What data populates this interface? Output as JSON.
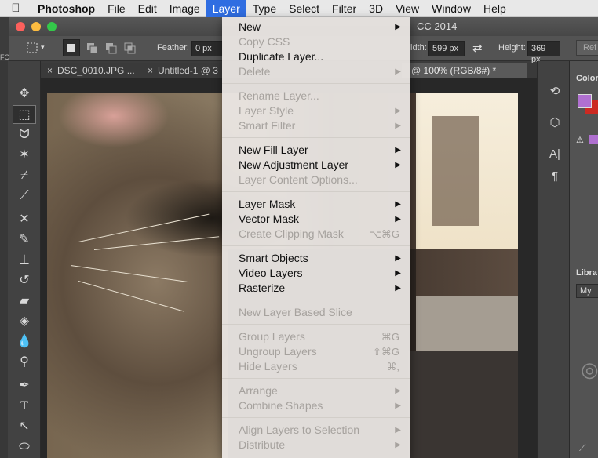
{
  "menubar": {
    "app": "Photoshop",
    "items": [
      "File",
      "Edit",
      "Image",
      "Layer",
      "Type",
      "Select",
      "Filter",
      "3D",
      "View",
      "Window",
      "Help"
    ],
    "active": "Layer"
  },
  "window": {
    "title_fragment": "CC 2014"
  },
  "options_bar": {
    "feather_label": "Feather:",
    "feather_value": "0 px",
    "width_label": "idth:",
    "width_value": "599 px",
    "height_label": "Height:",
    "height_value": "369 px",
    "refine_label": "Ref"
  },
  "tabs": [
    {
      "label": "DSC_0010.JPG ...",
      "active": false
    },
    {
      "label": "Untitled-1 @ 3",
      "active": false
    },
    {
      "label": "@ 100% (RGB/8#) *",
      "active": true
    }
  ],
  "left_edge_text": "FC",
  "tools": [
    "move-icon",
    "marquee-icon",
    "lasso-icon",
    "magic-wand-icon",
    "crop-icon",
    "eyedropper-icon",
    "healing-icon",
    "brush-icon",
    "stamp-icon",
    "history-brush-icon",
    "eraser-icon",
    "paint-bucket-icon",
    "blur-icon",
    "dodge-icon",
    "pen-icon",
    "type-icon",
    "path-select-icon",
    "shape-icon"
  ],
  "right_panel": {
    "color_label": "Color",
    "library_label": "Libra",
    "library_select": "My"
  },
  "layer_menu": {
    "items": [
      {
        "label": "New",
        "enabled": true,
        "submenu": true
      },
      {
        "label": "Copy CSS",
        "enabled": false
      },
      {
        "label": "Duplicate Layer...",
        "enabled": true
      },
      {
        "label": "Delete",
        "enabled": false,
        "submenu": true
      },
      {
        "label": "Rename Layer...",
        "enabled": false
      },
      {
        "label": "Layer Style",
        "enabled": false,
        "submenu": true
      },
      {
        "label": "Smart Filter",
        "enabled": false,
        "submenu": true
      },
      {
        "label": "New Fill Layer",
        "enabled": true,
        "submenu": true
      },
      {
        "label": "New Adjustment Layer",
        "enabled": true,
        "submenu": true
      },
      {
        "label": "Layer Content Options...",
        "enabled": false
      },
      {
        "label": "Layer Mask",
        "enabled": true,
        "submenu": true
      },
      {
        "label": "Vector Mask",
        "enabled": true,
        "submenu": true
      },
      {
        "label": "Create Clipping Mask",
        "enabled": false,
        "shortcut": "⌥⌘G"
      },
      {
        "label": "Smart Objects",
        "enabled": true,
        "submenu": true
      },
      {
        "label": "Video Layers",
        "enabled": true,
        "submenu": true
      },
      {
        "label": "Rasterize",
        "enabled": true,
        "submenu": true
      },
      {
        "label": "New Layer Based Slice",
        "enabled": false
      },
      {
        "label": "Group Layers",
        "enabled": false,
        "shortcut": "⌘G"
      },
      {
        "label": "Ungroup Layers",
        "enabled": false,
        "shortcut": "⇧⌘G"
      },
      {
        "label": "Hide Layers",
        "enabled": false,
        "shortcut": "⌘,"
      },
      {
        "label": "Arrange",
        "enabled": false,
        "submenu": true
      },
      {
        "label": "Combine Shapes",
        "enabled": false,
        "submenu": true
      },
      {
        "label": "Align Layers to Selection",
        "enabled": false,
        "submenu": true
      },
      {
        "label": "Distribute",
        "enabled": false,
        "submenu": true
      }
    ]
  }
}
